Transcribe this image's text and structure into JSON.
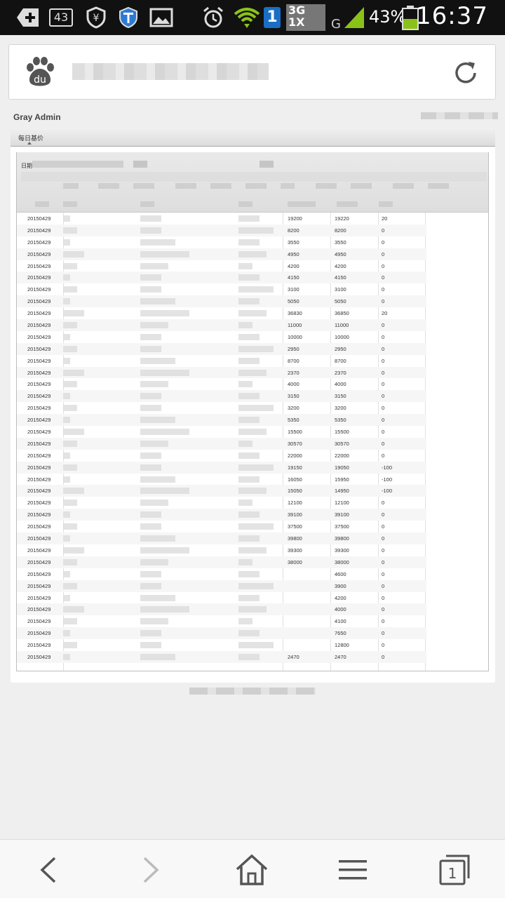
{
  "status_bar": {
    "notification_count": "43",
    "sim_slot": "1",
    "network_primary": "3G",
    "network_secondary": "1X",
    "network_g": "G",
    "battery_percent": "43%",
    "time": "16:37",
    "icons": [
      "add-notification-icon",
      "shield-yen-icon",
      "shield-t-icon",
      "image-icon",
      "alarm-icon",
      "wifi-icon",
      "signal-icon",
      "battery-icon"
    ]
  },
  "browser": {
    "logo": "du",
    "reload_icon": "reload-icon"
  },
  "page": {
    "title": "Gray Admin",
    "tab_label": "每日基价",
    "grid_header_label": "日期"
  },
  "table": {
    "rows": [
      {
        "date": "20150429",
        "a": "19200",
        "b": "19220",
        "c": "20"
      },
      {
        "date": "20150429",
        "a": "8200",
        "b": "8200",
        "c": "0"
      },
      {
        "date": "20150429",
        "a": "3550",
        "b": "3550",
        "c": "0"
      },
      {
        "date": "20150429",
        "a": "4950",
        "b": "4950",
        "c": "0"
      },
      {
        "date": "20150429",
        "a": "4200",
        "b": "4200",
        "c": "0"
      },
      {
        "date": "20150429",
        "a": "4150",
        "b": "4150",
        "c": "0"
      },
      {
        "date": "20150429",
        "a": "3100",
        "b": "3100",
        "c": "0"
      },
      {
        "date": "20150429",
        "a": "5050",
        "b": "5050",
        "c": "0"
      },
      {
        "date": "20150429",
        "a": "36830",
        "b": "36850",
        "c": "20"
      },
      {
        "date": "20150429",
        "a": "11000",
        "b": "11000",
        "c": "0"
      },
      {
        "date": "20150429",
        "a": "10000",
        "b": "10000",
        "c": "0"
      },
      {
        "date": "20150429",
        "a": "2950",
        "b": "2950",
        "c": "0"
      },
      {
        "date": "20150429",
        "a": "8700",
        "b": "8700",
        "c": "0"
      },
      {
        "date": "20150429",
        "a": "2370",
        "b": "2370",
        "c": "0"
      },
      {
        "date": "20150429",
        "a": "4000",
        "b": "4000",
        "c": "0"
      },
      {
        "date": "20150429",
        "a": "3150",
        "b": "3150",
        "c": "0"
      },
      {
        "date": "20150429",
        "a": "3200",
        "b": "3200",
        "c": "0"
      },
      {
        "date": "20150429",
        "a": "5350",
        "b": "5350",
        "c": "0"
      },
      {
        "date": "20150429",
        "a": "15500",
        "b": "15500",
        "c": "0"
      },
      {
        "date": "20150429",
        "a": "30570",
        "b": "30570",
        "c": "0"
      },
      {
        "date": "20150429",
        "a": "22000",
        "b": "22000",
        "c": "0"
      },
      {
        "date": "20150429",
        "a": "19150",
        "b": "19050",
        "c": "-100"
      },
      {
        "date": "20150429",
        "a": "16050",
        "b": "15950",
        "c": "-100"
      },
      {
        "date": "20150429",
        "a": "15050",
        "b": "14950",
        "c": "-100"
      },
      {
        "date": "20150429",
        "a": "12100",
        "b": "12100",
        "c": "0"
      },
      {
        "date": "20150429",
        "a": "39100",
        "b": "39100",
        "c": "0"
      },
      {
        "date": "20150429",
        "a": "37500",
        "b": "37500",
        "c": "0"
      },
      {
        "date": "20150429",
        "a": "39800",
        "b": "39800",
        "c": "0"
      },
      {
        "date": "20150429",
        "a": "39300",
        "b": "39300",
        "c": "0"
      },
      {
        "date": "20150429",
        "a": "38000",
        "b": "38000",
        "c": "0"
      },
      {
        "date": "20150429",
        "a": "",
        "b": "4600",
        "c": "0"
      },
      {
        "date": "20150429",
        "a": "",
        "b": "3900",
        "c": "0"
      },
      {
        "date": "20150429",
        "a": "",
        "b": "4200",
        "c": "0"
      },
      {
        "date": "20150429",
        "a": "",
        "b": "4000",
        "c": "0"
      },
      {
        "date": "20150429",
        "a": "",
        "b": "4100",
        "c": "0"
      },
      {
        "date": "20150429",
        "a": "",
        "b": "7650",
        "c": "0"
      },
      {
        "date": "20150429",
        "a": "",
        "b": "12800",
        "c": "0"
      },
      {
        "date": "20150429",
        "a": "2470",
        "b": "2470",
        "c": "0"
      }
    ]
  },
  "bottom_nav": {
    "tab_count": "1"
  }
}
